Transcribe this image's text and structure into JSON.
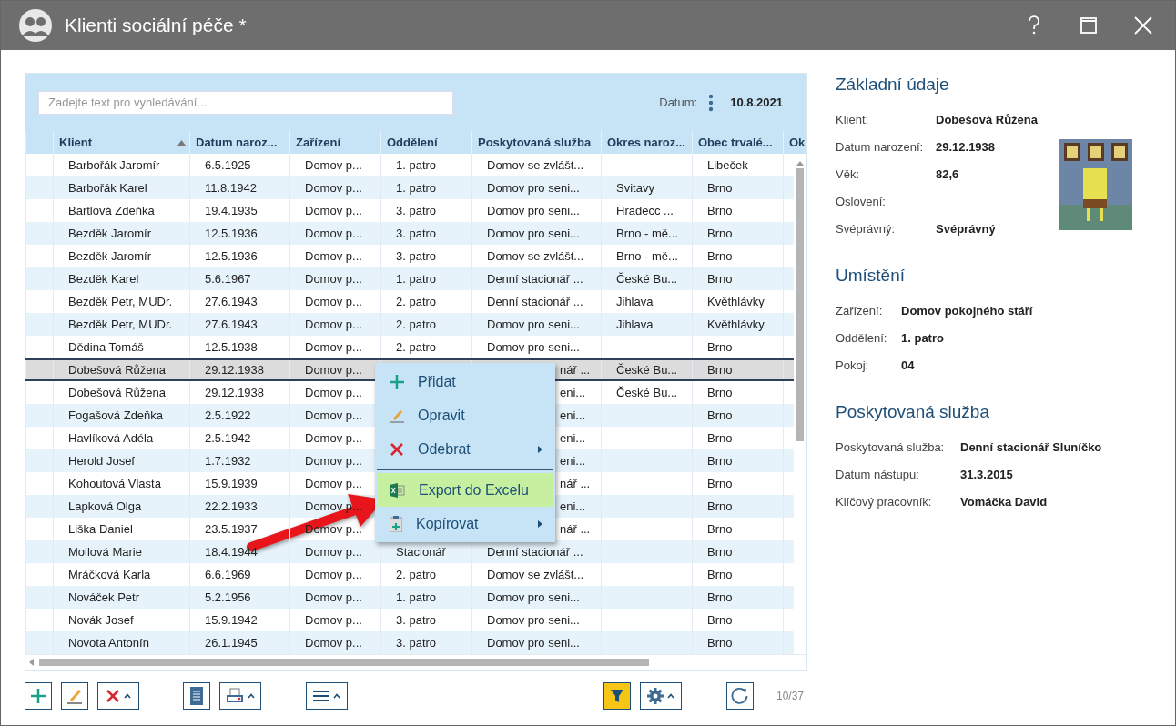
{
  "window": {
    "title": "Klienti sociální péče *"
  },
  "search": {
    "placeholder": "Zadejte text pro vyhledávání..."
  },
  "date": {
    "label": "Datum:",
    "value": "10.8.2021"
  },
  "table": {
    "columns": [
      "Klient",
      "Datum naroz...",
      "Zařízení",
      "Oddělení",
      "Poskytovaná služba",
      "Okres naroz...",
      "Obec trvalé...",
      "Ok"
    ],
    "rows": [
      {
        "cells": [
          "Barbořák Jaromír",
          "6.5.1925",
          "Domov p...",
          "1. patro",
          "Domov se zvlášt...",
          null,
          "Libeček"
        ],
        "selected": false
      },
      {
        "cells": [
          "Barbořák Karel",
          "11.8.1942",
          "Domov p...",
          "1. patro",
          "Domov pro seni...",
          "Svitavy",
          "Brno"
        ],
        "selected": false
      },
      {
        "cells": [
          "Bartlová Zdeňka",
          "19.4.1935",
          "Domov p...",
          "3. patro",
          "Domov pro seni...",
          "Hradecc ...",
          "Brno"
        ],
        "selected": false
      },
      {
        "cells": [
          "Bezděk Jaromír",
          "12.5.1936",
          "Domov p...",
          "3. patro",
          "Domov pro seni...",
          "Brno - mě...",
          "Brno"
        ],
        "selected": false
      },
      {
        "cells": [
          "Bezděk Jaromír",
          "12.5.1936",
          "Domov p...",
          "3. patro",
          "Domov se zvlášt...",
          "Brno - mě...",
          "Brno"
        ],
        "selected": false
      },
      {
        "cells": [
          "Bezděk Karel",
          "5.6.1967",
          "Domov p...",
          "1. patro",
          "Denní stacionář ...",
          "České Bu...",
          "Brno"
        ],
        "selected": false
      },
      {
        "cells": [
          "Bezděk Petr, MUDr.",
          "27.6.1943",
          "Domov p...",
          "2. patro",
          "Denní stacionář ...",
          "Jihlava",
          "Květhlávky"
        ],
        "selected": false
      },
      {
        "cells": [
          "Bezděk Petr, MUDr.",
          "27.6.1943",
          "Domov p...",
          "2. patro",
          "Domov pro seni...",
          "Jihlava",
          "Květhlávky"
        ],
        "selected": false
      },
      {
        "cells": [
          "Dědina Tomáš",
          "12.5.1938",
          "Domov p...",
          "2. patro",
          "Domov pro seni...",
          null,
          "Brno"
        ],
        "selected": false
      },
      {
        "cells": [
          "Dobešová Růžena",
          "29.12.1938",
          "Domov p...",
          null,
          {
            "text": "nář ...",
            "partial": true
          },
          "České Bu...",
          "Brno"
        ],
        "selected": true
      },
      {
        "cells": [
          "Dobešová Růžena",
          "29.12.1938",
          "Domov p...",
          null,
          {
            "text": "eni...",
            "partial": true
          },
          "České Bu...",
          "Brno"
        ],
        "selected": false
      },
      {
        "cells": [
          "Fogašová Zdeňka",
          "2.5.1922",
          "Domov p...",
          null,
          {
            "text": "eni...",
            "partial": true
          },
          null,
          "Brno"
        ],
        "selected": false
      },
      {
        "cells": [
          "Havlíková Adéla",
          "2.5.1942",
          "Domov p...",
          null,
          {
            "text": "eni...",
            "partial": true
          },
          null,
          "Brno"
        ],
        "selected": false
      },
      {
        "cells": [
          "Herold Josef",
          "1.7.1932",
          "Domov p...",
          null,
          {
            "text": "eni...",
            "partial": true
          },
          null,
          "Brno"
        ],
        "selected": false
      },
      {
        "cells": [
          "Kohoutová Vlasta",
          "15.9.1939",
          "Domov p...",
          null,
          {
            "text": "nář ...",
            "partial": true
          },
          null,
          "Brno"
        ],
        "selected": false
      },
      {
        "cells": [
          "Lapková Olga",
          "22.2.1933",
          "Domov p...",
          null,
          {
            "text": "eni...",
            "partial": true
          },
          null,
          "Brno"
        ],
        "selected": false
      },
      {
        "cells": [
          "Liška Daniel",
          "23.5.1937",
          "Domov p...",
          null,
          {
            "text": "nář ...",
            "partial": true
          },
          null,
          "Brno"
        ],
        "selected": false
      },
      {
        "cells": [
          "Mollová Marie",
          "18.4.1944",
          "Domov p...",
          "Stacionář",
          "Denní stacionář ...",
          null,
          "Brno"
        ],
        "selected": false
      },
      {
        "cells": [
          "Mráčková Karla",
          "6.6.1969",
          "Domov p...",
          "2. patro",
          "Domov se zvlášt...",
          null,
          "Brno"
        ],
        "selected": false
      },
      {
        "cells": [
          "Nováček Petr",
          "5.2.1956",
          "Domov p...",
          "1. patro",
          "Domov pro seni...",
          null,
          "Brno"
        ],
        "selected": false
      },
      {
        "cells": [
          "Novák Josef",
          "15.9.1942",
          "Domov p...",
          "3. patro",
          "Domov pro seni...",
          null,
          "Brno"
        ],
        "selected": false
      },
      {
        "cells": [
          "Novota Antonín",
          "26.1.1945",
          "Domov p...",
          "3. patro",
          "Domov pro seni...",
          null,
          "Brno"
        ],
        "selected": false
      }
    ]
  },
  "context_menu": {
    "items": [
      {
        "kind": "add",
        "label": "Přidat",
        "highlighted": false,
        "submenu": false
      },
      {
        "kind": "edit",
        "label": "Opravit",
        "highlighted": false,
        "submenu": false
      },
      {
        "kind": "remove",
        "label": "Odebrat",
        "highlighted": false,
        "submenu": true
      },
      {
        "kind": "separator"
      },
      {
        "kind": "excel",
        "label": "Export do Excelu",
        "highlighted": true,
        "submenu": false
      },
      {
        "kind": "copy",
        "label": "Kopírovat",
        "highlighted": false,
        "submenu": true
      }
    ]
  },
  "toolbar": {
    "buttons": [
      {
        "kind": "add",
        "has_menu": false,
        "active": false
      },
      {
        "kind": "edit",
        "has_menu": false,
        "active": false
      },
      {
        "kind": "remove",
        "has_menu": true,
        "active": false
      },
      {
        "kind": "document",
        "has_menu": false,
        "active": false
      },
      {
        "kind": "print",
        "has_menu": true,
        "active": false
      },
      {
        "kind": "list",
        "has_menu": true,
        "active": false
      },
      {
        "kind": "filter",
        "has_menu": false,
        "active": true
      },
      {
        "kind": "settings",
        "has_menu": true,
        "active": false
      },
      {
        "kind": "refresh",
        "has_menu": false,
        "active": false
      }
    ],
    "count": "10/37"
  },
  "details": {
    "sections": [
      {
        "title": "Základní údaje",
        "photo": {
          "kind": "picture"
        },
        "fields": [
          {
            "label": "Klient:",
            "value": "Dobešová Růžena"
          },
          {
            "label": "Datum narození:",
            "value": "29.12.1938"
          },
          {
            "label": "Věk:",
            "value": "82,6"
          },
          {
            "label": "Oslovení:"
          },
          {
            "label": "Svéprávný:",
            "value": "Svéprávný"
          }
        ]
      },
      {
        "title": "Umístění",
        "fields": [
          {
            "label": "Zařízení:",
            "value": "Domov pokojného stáří"
          },
          {
            "label": "Oddělení:",
            "value": "1. patro"
          },
          {
            "label": "Pokoj:",
            "value": "04"
          }
        ]
      },
      {
        "title": "Poskytovaná služba",
        "fields": [
          {
            "label": "Poskytovaná služba:",
            "value": "Denní stacionář Sluníčko"
          },
          {
            "label": "Datum nástupu:",
            "value": "31.3.2015"
          },
          {
            "label": "Klíčový pracovník:",
            "value": "Vomáčka David"
          }
        ]
      }
    ]
  }
}
